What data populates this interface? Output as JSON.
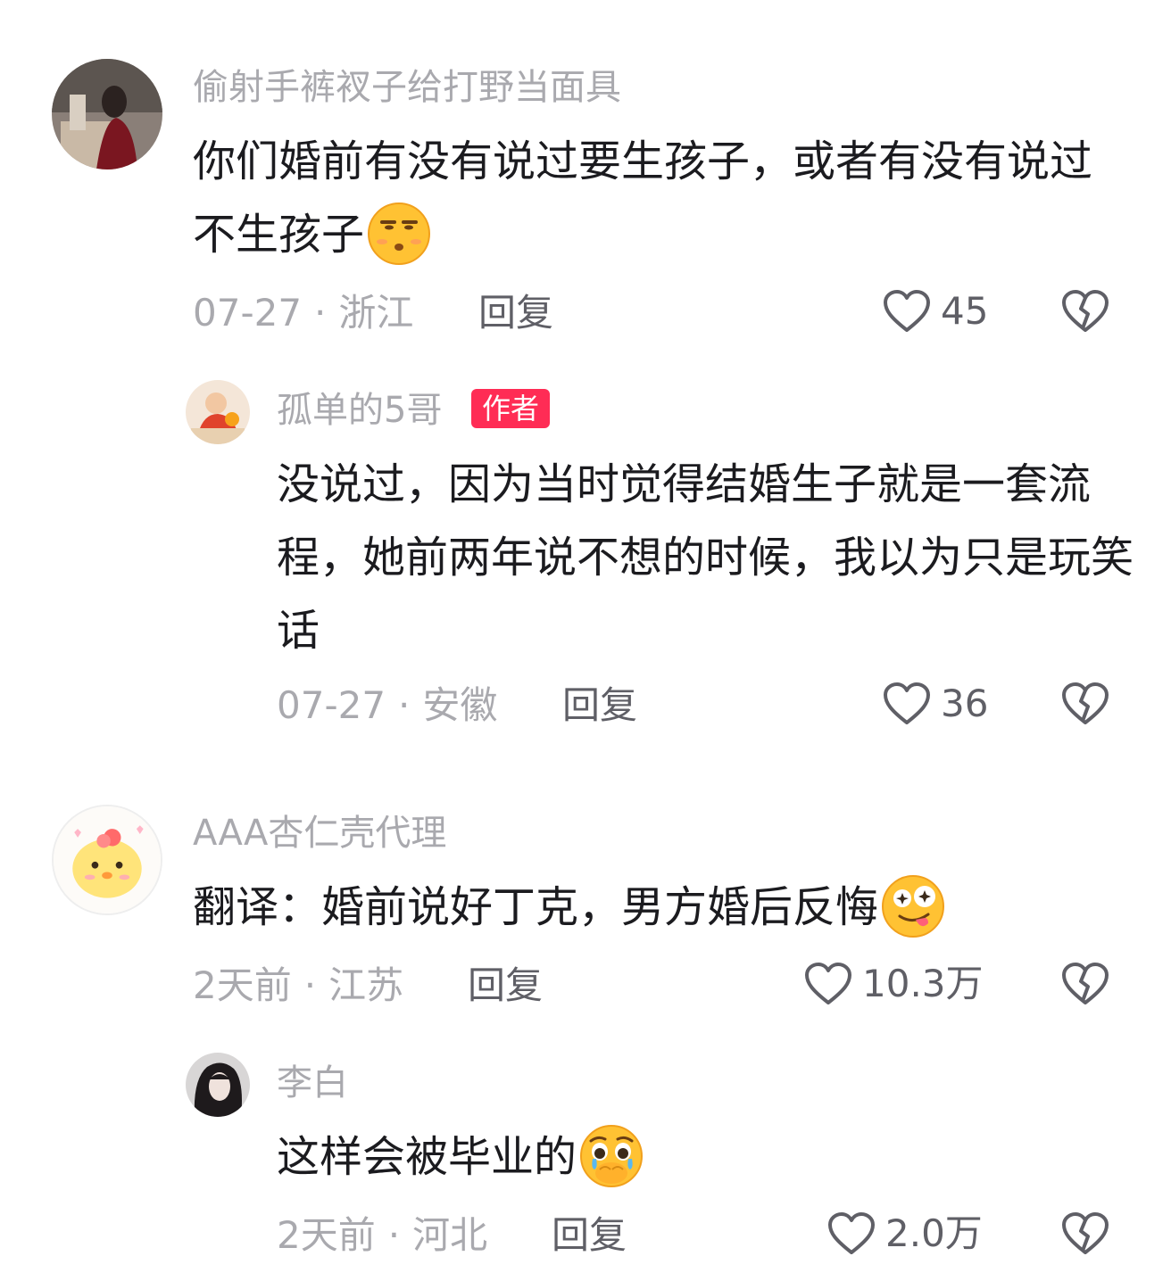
{
  "comments": [
    {
      "username": "偷射手裤衩子给打野当面具",
      "text": "你们婚前有没有说过要生孩子，或者有没有说过不生孩子",
      "emoji": "smirk-face-emoji",
      "date": "07-27",
      "location": "浙江",
      "reply_label": "回复",
      "likes": "45"
    },
    {
      "username": "孤单的5哥",
      "badge": "作者",
      "text": "没说过，因为当时觉得结婚生子就是一套流程，她前两年说不想的时候，我以为只是玩笑话",
      "date": "07-27",
      "location": "安徽",
      "reply_label": "回复",
      "likes": "36"
    },
    {
      "username": "AAA杏仁壳代理",
      "text": "翻译：婚前说好丁克，男方婚后反悔",
      "emoji": "silly-star-eyes-emoji",
      "date": "2天前",
      "location": "江苏",
      "reply_label": "回复",
      "likes": "10.3万"
    },
    {
      "username": "李白",
      "text": "这样会被毕业的",
      "emoji": "holding-back-tears-emoji",
      "date": "2天前",
      "location": "河北",
      "reply_label": "回复",
      "likes": "2.0万"
    }
  ],
  "icons": {
    "like": "heart-outline-icon",
    "dislike": "broken-heart-icon"
  },
  "colors": {
    "badge": "#ff2c55",
    "muted_text": "#a9a9ae",
    "body_text": "#1b1b1f",
    "action_text": "#5f5f66"
  }
}
